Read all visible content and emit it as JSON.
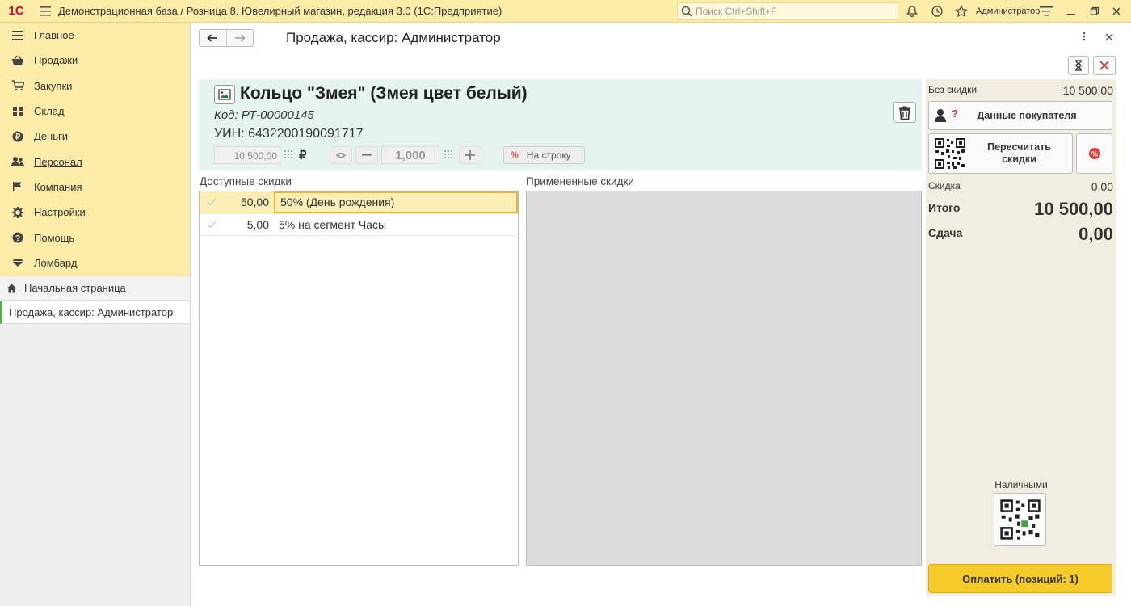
{
  "topbar": {
    "logo_text": "1С",
    "title": "Демонстрационная база / Розница 8. Ювелирный магазин, редакция 3.0  (1С:Предприятие)",
    "search_placeholder": "Поиск Ctrl+Shift+F",
    "user": "Администратор"
  },
  "sidebar": {
    "items": [
      {
        "label": "Главное",
        "icon": "menu-icon"
      },
      {
        "label": "Продажи",
        "icon": "basket-icon"
      },
      {
        "label": "Закупки",
        "icon": "cart-icon"
      },
      {
        "label": "Склад",
        "icon": "warehouse-icon"
      },
      {
        "label": "Деньги",
        "icon": "money-icon"
      },
      {
        "label": "Персонал",
        "icon": "people-icon"
      },
      {
        "label": "Компания",
        "icon": "flag-icon"
      },
      {
        "label": "Настройки",
        "icon": "gear-icon"
      },
      {
        "label": "Помощь",
        "icon": "help-icon"
      },
      {
        "label": "Ломбард",
        "icon": "diamond-icon"
      }
    ],
    "home_label": "Начальная страница",
    "open_window": "Продажа, кассир: Администратор"
  },
  "form": {
    "title": "Продажа, кассир: Администратор"
  },
  "product": {
    "name": "Кольцо \"Змея\" (Змея цвет белый)",
    "code": "Код: РТ-00000145",
    "uin": "УИН: 6432200190091717",
    "price": "10 500,00",
    "currency": "₽",
    "quantity": "1,000",
    "to_row_label": "На строку",
    "to_row_pct": "%"
  },
  "discounts": {
    "available_label": "Доступные скидки",
    "applied_label": "Примененные скидки",
    "available": [
      {
        "value": "50,00",
        "name": "50% (День рождения)",
        "selected": true
      },
      {
        "value": "5,00",
        "name": "5% на сегмент Часы",
        "selected": false
      }
    ]
  },
  "summary": {
    "no_discount_label": "Без скидки",
    "no_discount_value": "10 500,00",
    "buyer_button": "Данные покупателя",
    "recalc_button_line1": "Пересчитать",
    "recalc_button_line2": "скидки",
    "discount_label": "Скидка",
    "discount_value": "0,00",
    "total_label": "Итого",
    "total_value": "10 500,00",
    "change_label": "Сдача",
    "change_value": "0,00",
    "cash_label": "Наличными",
    "pay_button": "Оплатить (позиций: 1)"
  },
  "colors": {
    "topbar": "#fbeca8",
    "product_panel": "#e5f4ee",
    "right_panel": "#f1eee1",
    "pay_button": "#f5cb2b",
    "selected_row": "#fbeeb6"
  }
}
